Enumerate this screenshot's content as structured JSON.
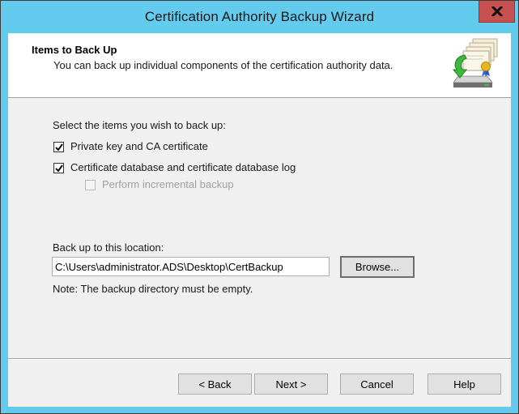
{
  "window": {
    "title": "Certification Authority Backup Wizard",
    "close_icon": "close-icon",
    "close_label": "X"
  },
  "header": {
    "title": "Items to Back Up",
    "subtitle": "You can back up individual components of the certification authority data.",
    "icon": "certificate-backup-icon"
  },
  "body": {
    "select_prompt": "Select the items you wish to back up:",
    "options": [
      {
        "label": "Private key and CA certificate",
        "checked": true,
        "enabled": true
      },
      {
        "label": "Certificate database and certificate database log",
        "checked": true,
        "enabled": true
      },
      {
        "label": "Perform incremental backup",
        "checked": false,
        "enabled": false
      }
    ],
    "location_label": "Back up to this location:",
    "location_value": "C:\\Users\\administrator.ADS\\Desktop\\CertBackup",
    "browse_label": "Browse...",
    "note": "Note: The backup directory must be empty."
  },
  "footer": {
    "back_label": "< Back",
    "next_label": "Next >",
    "cancel_label": "Cancel",
    "help_label": "Help"
  },
  "colors": {
    "frame": "#63cbed",
    "close_button": "#c75050",
    "dialog_bg": "#f0f0f0",
    "header_bg": "#ffffff"
  }
}
